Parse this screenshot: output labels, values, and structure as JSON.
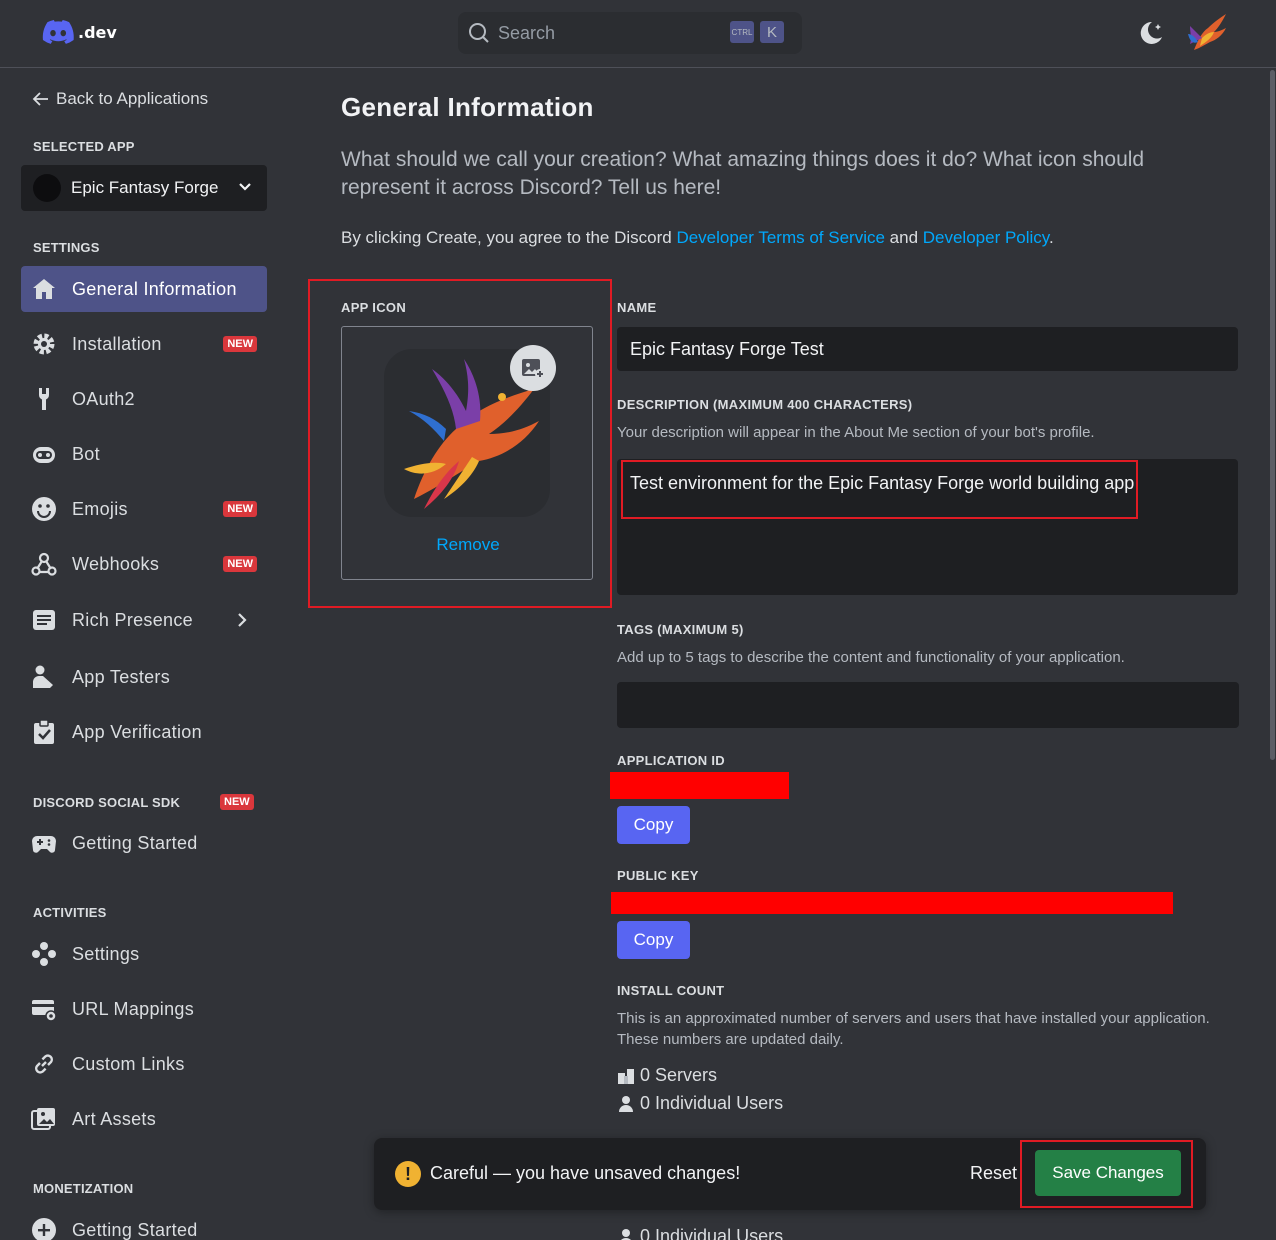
{
  "header": {
    "logo_text": ".dev",
    "search_placeholder": "Search",
    "kbd_ctrl": "CTRL",
    "kbd_k": "K"
  },
  "sidebar": {
    "back_label": "Back to Applications",
    "selected_app_label": "SELECTED APP",
    "selected_app_name": "Epic Fantasy Forge",
    "settings_label": "SETTINGS",
    "settings_items": [
      {
        "label": "General Information",
        "icon": "home-icon",
        "active": true
      },
      {
        "label": "Installation",
        "icon": "gear-icon",
        "badge": "NEW"
      },
      {
        "label": "OAuth2",
        "icon": "wrench-icon"
      },
      {
        "label": "Bot",
        "icon": "bot-icon"
      },
      {
        "label": "Emojis",
        "icon": "smile-icon",
        "badge": "NEW"
      },
      {
        "label": "Webhooks",
        "icon": "webhook-icon",
        "badge": "NEW"
      },
      {
        "label": "Rich Presence",
        "icon": "document-icon"
      },
      {
        "label": "App Testers",
        "icon": "user-wrench-icon"
      },
      {
        "label": "App Verification",
        "icon": "clipboard-check-icon"
      }
    ],
    "sdk_label": "DISCORD SOCIAL SDK",
    "sdk_badge": "NEW",
    "sdk_items": [
      {
        "label": "Getting Started",
        "icon": "gamepad-icon"
      }
    ],
    "activities_label": "ACTIVITIES",
    "activities_items": [
      {
        "label": "Settings",
        "icon": "dots-icon"
      },
      {
        "label": "URL Mappings",
        "icon": "card-gear-icon"
      },
      {
        "label": "Custom Links",
        "icon": "link-icon"
      },
      {
        "label": "Art Assets",
        "icon": "image-icon"
      }
    ],
    "monetization_label": "MONETIZATION",
    "monetization_items": [
      {
        "label": "Getting Started",
        "icon": "plus-circle-icon"
      }
    ]
  },
  "main": {
    "title": "General Information",
    "subtitle": "What should we call your creation? What amazing things does it do? What icon should represent it across Discord? Tell us here!",
    "terms_prefix": "By clicking Create, you agree to the Discord ",
    "terms_link1": "Developer Terms of Service",
    "terms_mid": " and ",
    "terms_link2": "Developer Policy",
    "terms_suffix": ".",
    "app_icon_label": "APP ICON",
    "remove_label": "Remove",
    "name_label": "NAME",
    "name_value": "Epic Fantasy Forge Test",
    "description_label": "DESCRIPTION (MAXIMUM 400 CHARACTERS)",
    "description_helper": "Your description will appear in the About Me section of your bot's profile.",
    "description_value": "Test environment for the Epic Fantasy Forge world building app",
    "tags_label": "TAGS (MAXIMUM 5)",
    "tags_helper": "Add up to 5 tags to describe the content and functionality of your application.",
    "app_id_label": "APPLICATION ID",
    "public_key_label": "PUBLIC KEY",
    "copy_label": "Copy",
    "install_label": "INSTALL COUNT",
    "install_helper_1": "This is an approximated number of servers and users that have installed your application.",
    "install_helper_2": "These numbers are updated daily.",
    "servers_text": "0 Servers",
    "users_text": "0 Individual Users"
  },
  "unsaved_bar": {
    "warning_text": "Careful — you have unsaved changes!",
    "reset_label": "Reset",
    "save_label": "Save Changes"
  },
  "colors": {
    "background": "#313338",
    "accent": "#5865f2",
    "active_nav": "#4e5388",
    "link": "#00a8fc",
    "danger": "#da373c",
    "success": "#248046",
    "highlight_outline": "#e01b24"
  }
}
